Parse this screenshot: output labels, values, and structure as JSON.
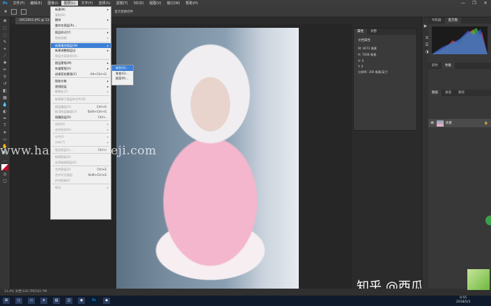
{
  "menubar": {
    "items": [
      "文件(F)",
      "编辑(E)",
      "图像(I)",
      "图层(L)",
      "文字(Y)",
      "选择(S)",
      "滤镜(T)",
      "3D(D)",
      "视图(V)",
      "窗口(W)",
      "帮助(H)"
    ],
    "active_index": 3
  },
  "window_controls": [
    "—",
    "❐",
    "✕"
  ],
  "document_tab": "00C2B52 JPG @ 13.4%(RGB/8#)",
  "options_bar": {
    "item1": "显示变换控件"
  },
  "layer_menu": [
    {
      "label": "新建(N)",
      "shortcut": "",
      "arrow": true
    },
    {
      "label": "复制(D)",
      "shortcut": "",
      "disabled": true
    },
    {
      "label": "删除",
      "shortcut": "",
      "arrow": true
    },
    {
      "label": "重命名图层(R)...",
      "shortcut": ""
    },
    {
      "sep": true
    },
    {
      "label": "图层样式(Y)",
      "shortcut": "",
      "arrow": true
    },
    {
      "label": "智能滤镜",
      "shortcut": "",
      "arrow": true,
      "disabled": true
    },
    {
      "sep": true
    },
    {
      "label": "新建填充图层(W)",
      "shortcut": "",
      "arrow": true
    },
    {
      "label": "新建调整图层(J)",
      "shortcut": "",
      "arrow": true
    },
    {
      "label": "图层内容选项(O)...",
      "shortcut": "",
      "disabled": true
    },
    {
      "sep": true
    },
    {
      "label": "图层蒙版(M)",
      "shortcut": "",
      "arrow": true
    },
    {
      "label": "矢量蒙版(V)",
      "shortcut": "",
      "arrow": true
    },
    {
      "label": "创建剪贴蒙版(C)",
      "shortcut": "Alt+Ctrl+G"
    },
    {
      "sep": true
    },
    {
      "label": "智能对象",
      "shortcut": "",
      "arrow": true
    },
    {
      "label": "视频图层",
      "shortcut": "",
      "arrow": true
    },
    {
      "label": "栅格化(Z)",
      "shortcut": "",
      "arrow": true,
      "disabled": true
    },
    {
      "sep": true
    },
    {
      "label": "新建基于图层的切片(B)",
      "shortcut": "",
      "disabled": true
    },
    {
      "sep": true
    },
    {
      "label": "图层编组(G)",
      "shortcut": "Ctrl+G",
      "disabled": true
    },
    {
      "label": "取消图层编组(U)",
      "shortcut": "Shift+Ctrl+G",
      "disabled": true
    },
    {
      "label": "隐藏图层(R)",
      "shortcut": "Ctrl+,"
    },
    {
      "sep": true
    },
    {
      "label": "排列(A)",
      "shortcut": "",
      "arrow": true,
      "disabled": true
    },
    {
      "label": "合并形状(H)",
      "shortcut": "",
      "arrow": true,
      "disabled": true
    },
    {
      "sep": true
    },
    {
      "label": "对齐(I)",
      "shortcut": "",
      "arrow": true,
      "disabled": true
    },
    {
      "label": "分布(T)",
      "shortcut": "",
      "arrow": true,
      "disabled": true
    },
    {
      "sep": true
    },
    {
      "label": "锁定图层(L)...",
      "shortcut": "Ctrl+/",
      "disabled": true
    },
    {
      "sep": true
    },
    {
      "label": "链接图层(K)",
      "shortcut": "",
      "disabled": true
    },
    {
      "label": "选择链接图层(S)",
      "shortcut": "",
      "disabled": true
    },
    {
      "sep": true
    },
    {
      "label": "合并图层(E)",
      "shortcut": "Ctrl+E",
      "disabled": true
    },
    {
      "label": "合并可见图层",
      "shortcut": "Shift+Ctrl+E",
      "disabled": true
    },
    {
      "label": "拼合图像(F)",
      "shortcut": "",
      "disabled": true
    },
    {
      "sep": true
    },
    {
      "label": "修边",
      "shortcut": "",
      "arrow": true,
      "disabled": true
    }
  ],
  "highlighted_item": "新建填充图层(W)",
  "submenu_items": [
    "纯色(O)...",
    "渐变(G)...",
    "图案(R)..."
  ],
  "props_panel": {
    "tabs": [
      "属性",
      "调整"
    ],
    "title": "文档属性",
    "rows": [
      "W: 4672 像素",
      "H: 7008 像素",
      "X: 0",
      "Y: 0",
      "分辨率: 300 像素/英寸"
    ]
  },
  "right_panels": {
    "top_tabs": [
      "导航器",
      "直方图"
    ],
    "mid_tabs": [
      "颜色",
      "色板"
    ],
    "layers_tabs": [
      "图层",
      "通道",
      "路径"
    ],
    "layer_name": "背景"
  },
  "statusbar": "13.4%   文档:102.7M/102.7M",
  "watermark": "www.hanjiadansheji.com",
  "credit": "知乎 @西瓜呆毛汪",
  "clock": {
    "time": "0:55",
    "date": "2018/5/3"
  },
  "colors": {
    "highlight": "#3c7fd6",
    "menu_bg": "#f0f0f0",
    "ps_panel": "#3a3a3a"
  }
}
